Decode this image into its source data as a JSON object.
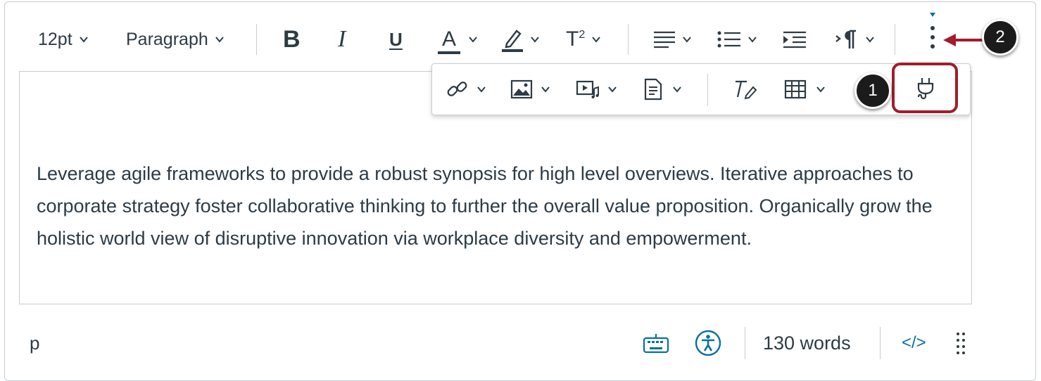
{
  "toolbar": {
    "font_size": "12pt",
    "block_format": "Paragraph",
    "bold": "B",
    "italic": "I",
    "underline": "U",
    "text_color": "A",
    "superscript": "T",
    "superscript_digit": "2",
    "more_label": "⋮"
  },
  "more_toolbar": {
    "icons": [
      "link-icon",
      "image-icon",
      "media-icon",
      "document-icon",
      "clear-formatting-icon",
      "table-icon",
      "plugin-icon"
    ]
  },
  "editor": {
    "text": "Leverage agile frameworks to provide a robust synopsis for high level overviews. Iterative approaches to corporate strategy foster collaborative thinking to further the overall value proposition. Organically grow the holistic world view of disruptive innovation via workplace diversity and empowerment."
  },
  "callouts": {
    "one": "1",
    "two": "2"
  },
  "status_bar": {
    "element_path": "p",
    "word_count": "130 words",
    "html_toggle": "</>"
  },
  "colors": {
    "text": "#2d3b45",
    "highlight": "#a31c2a",
    "link": "#0770a3",
    "border": "#c7cdd1"
  }
}
